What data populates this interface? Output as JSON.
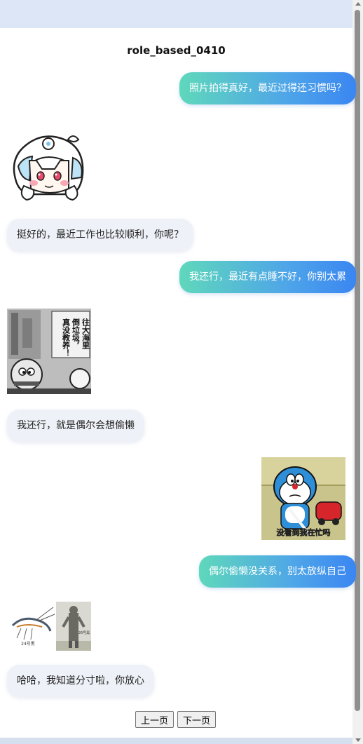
{
  "page": {
    "title": "role_based_0410"
  },
  "messages": [
    {
      "role": "user",
      "text": "照片拍得真好，最近过得还习惯吗？"
    },
    {
      "role": "bot",
      "type": "sticker",
      "icon": "anime-girl-sticker"
    },
    {
      "role": "bot",
      "text": "挺好的，最近工作也比较顺利，你呢？"
    },
    {
      "role": "user",
      "text": "我还行，最近有点睡不好，你别太累"
    },
    {
      "role": "bot",
      "type": "sticker",
      "icon": "manga-doraemon-sticker",
      "caption": "往大海里倒垃圾，真没教养！"
    },
    {
      "role": "bot",
      "text": "我还行，就是偶尔会想偷懒"
    },
    {
      "role": "user",
      "type": "sticker",
      "icon": "doraemon-vacuum-sticker",
      "caption": "没看到我在忙吗"
    },
    {
      "role": "user",
      "text": "偶尔偷懒没关系，别太放纵自己"
    },
    {
      "role": "bot",
      "type": "sticker",
      "icon": "shrimp-and-ultraman-sticker",
      "caption_left": "24号黑",
      "caption_right": "26号黑"
    },
    {
      "role": "bot",
      "text": "哈哈，我知道分寸啦，你放心"
    }
  ],
  "pager": {
    "prev_label": "上一页",
    "next_label": "下一页"
  },
  "colors": {
    "user_bubble_start": "#5fd8bb",
    "user_bubble_end": "#3a86f2",
    "bot_bubble": "#eef1f7"
  }
}
